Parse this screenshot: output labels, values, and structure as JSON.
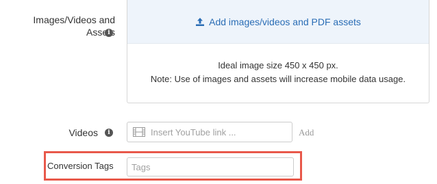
{
  "assets": {
    "label": "Images/Videos and Assets",
    "info_icon": "info-icon",
    "upload_label": "Add images/videos and PDF assets",
    "upload_icon": "upload-icon",
    "info_line_1": "Ideal image size 450 x 450 px.",
    "info_line_2": "Note: Use of images and assets will increase mobile data usage."
  },
  "videos": {
    "label": "Videos",
    "info_icon": "info-icon",
    "input_icon": "film-icon",
    "placeholder": "Insert YouTube link ...",
    "value": "",
    "add_label": "Add"
  },
  "conversion_tags": {
    "label": "Conversion Tags",
    "placeholder": "Tags",
    "value": "",
    "highlight_color": "#e8584a"
  },
  "colors": {
    "link_blue": "#2a6db5",
    "header_bg": "#eef4fb"
  }
}
